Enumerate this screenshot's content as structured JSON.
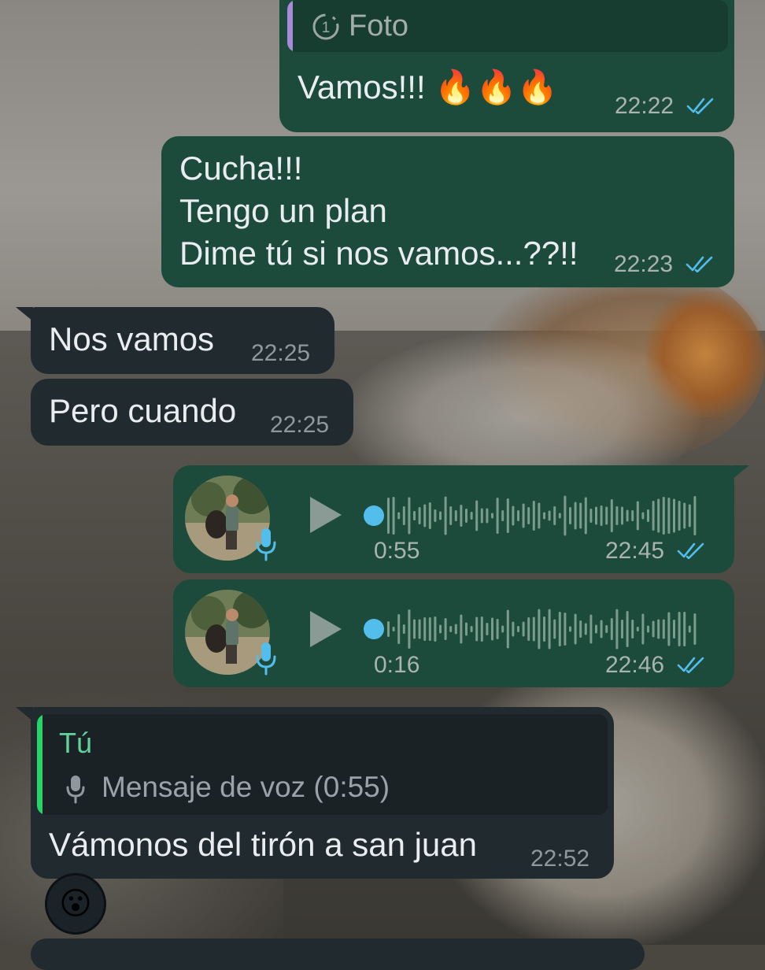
{
  "messages": {
    "m1": {
      "quote_label": "Foto",
      "text": "Vamos!!! 🔥🔥🔥",
      "time": "22:22"
    },
    "m2": {
      "line1": "Cucha!!!",
      "line2": "Tengo un plan",
      "line3": "Dime tú si nos vamos...??!!",
      "time": "22:23"
    },
    "m3": {
      "text": "Nos vamos",
      "time": "22:25"
    },
    "m4": {
      "text": "Pero cuando",
      "time": "22:25"
    },
    "m5": {
      "duration": "0:55",
      "time": "22:45",
      "progress": 0
    },
    "m6": {
      "duration": "0:16",
      "time": "22:46",
      "progress": 0
    },
    "m7": {
      "quote_author": "Tú",
      "quote_text": "Mensaje de voz (0:55)",
      "text": "Vámonos del tirón a san juan",
      "time": "22:52",
      "reaction": "😮"
    }
  },
  "colors": {
    "outgoing_bubble": "#1d4b3b",
    "incoming_bubble": "#212a2f",
    "read_ticks": "#53bdeb",
    "quote_bar_photo": "#a68bd6",
    "quote_bar_self": "#25d366",
    "quote_author": "#62d29b"
  },
  "icons": {
    "view_once": "view-once-icon",
    "read": "double-check-icon",
    "play": "play-icon",
    "mic": "mic-icon"
  }
}
